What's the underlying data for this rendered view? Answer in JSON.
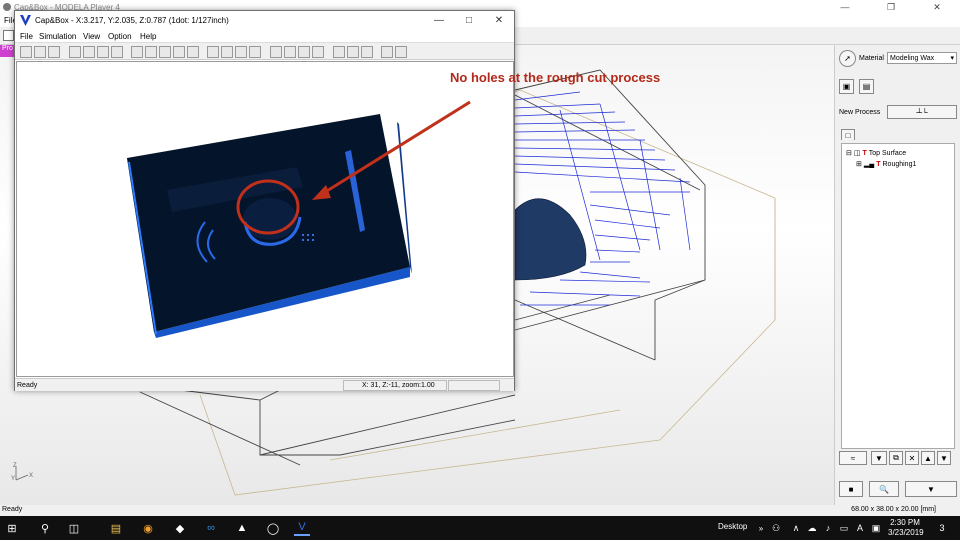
{
  "main_window": {
    "title": "Cap&Box - MODELA Player 4",
    "menu_first": "File",
    "pink_tab_label": "Pro",
    "status": "Ready",
    "dimensions": "68.00 x 38.00 x 20.00 [mm]"
  },
  "right_panel": {
    "material_label": "Material",
    "material_value": "Modeling Wax",
    "new_process_label": "New Process",
    "tree": [
      {
        "label": "Top Surface",
        "expander": "⊟"
      },
      {
        "label": "Roughing1",
        "expander": "⊞"
      }
    ]
  },
  "capbox_window": {
    "title": "Cap&Box - X:3.217, Y:2.035, Z:0.787 (1dot: 1/127inch)",
    "menus": [
      "File",
      "Simulation",
      "View",
      "Option",
      "Help"
    ],
    "status": "Ready",
    "coords": "X: 31, Z:-11, zoom:1.00"
  },
  "annotation": "No holes at the rough cut process",
  "taskbar": {
    "desktop_label": "Desktop",
    "time": "2:30 PM",
    "date": "3/23/2019",
    "notification_count": "3"
  },
  "colors": {
    "annotation_red": "#b22a1a",
    "toolpath_blue": "#1f2bd6",
    "block_dark": "#04142a",
    "block_side_blue": "#1a6fe8"
  }
}
